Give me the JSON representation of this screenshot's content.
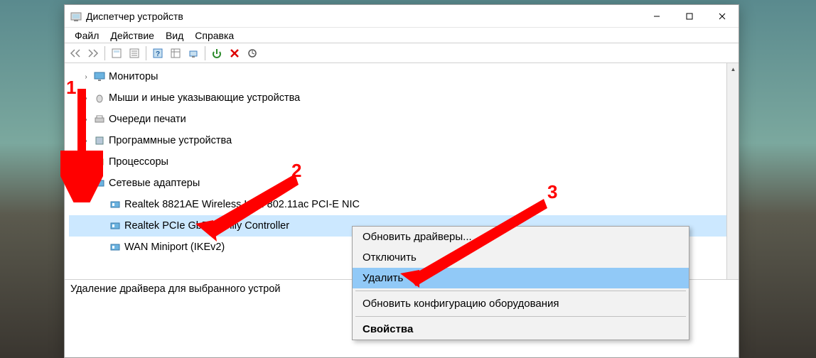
{
  "window": {
    "title": "Диспетчер устройств"
  },
  "menu": {
    "file": "Файл",
    "action": "Действие",
    "view": "Вид",
    "help": "Справка"
  },
  "tree": {
    "monitors": "Мониторы",
    "mice": "Мыши и иные указывающие устройства",
    "print_queues": "Очереди печати",
    "software_devices": "Программные устройства",
    "processors": "Процессоры",
    "network_adapters": "Сетевые адаптеры",
    "adapter1": "Realtek 8821AE Wireless LAN 802.11ac PCI-E NIC",
    "adapter2": "Realtek PCIe GbE Family Controller",
    "adapter3": "WAN Miniport (IKEv2)"
  },
  "status": "Удаление драйвера для выбранного устрой",
  "context": {
    "update": "Обновить драйверы...",
    "disable": "Отключить",
    "uninstall": "Удалить",
    "scan": "Обновить конфигурацию оборудования",
    "props": "Свойства"
  },
  "annot": {
    "n1": "1",
    "n2": "2",
    "n3": "3"
  }
}
